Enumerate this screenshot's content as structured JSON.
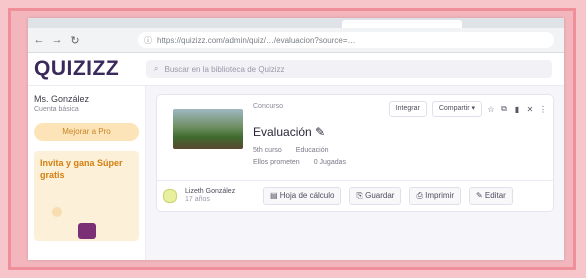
{
  "browser": {
    "address": "https://quizizz.com/admin/quiz/…/evaluacion?source=…",
    "nav": {
      "back": "←",
      "forward": "→",
      "reload": "↻"
    }
  },
  "app": {
    "logo": "QUIZIZZ",
    "search_placeholder": "Buscar en la biblioteca de Quizizz"
  },
  "sidebar": {
    "user_name": "Ms. González",
    "user_sub": "Cuenta básica",
    "upgrade_label": "Mejorar a Pro",
    "promo_title": "Invita y gana Súper gratis"
  },
  "quiz": {
    "type": "Concurso",
    "title": "Evaluación",
    "meta": [
      "5th curso",
      "Educación",
      "Ellos prometen",
      "0 Jugadas"
    ],
    "toolbar": {
      "integrate": "Integrar",
      "share": "Compartir ▾"
    },
    "author_name": "Lizeth González",
    "author_sub": "17 años",
    "actions": {
      "worksheet": "Hoja de cálculo",
      "save": "Guardar",
      "print": "Imprimir",
      "edit": "Editar"
    }
  },
  "colors": {
    "page_bg": "#f7c6cb",
    "frame_border": "#ef8f9a",
    "logo": "#3a2a5c",
    "upgrade": "#fde4b8",
    "promo_title": "#d37f10"
  }
}
